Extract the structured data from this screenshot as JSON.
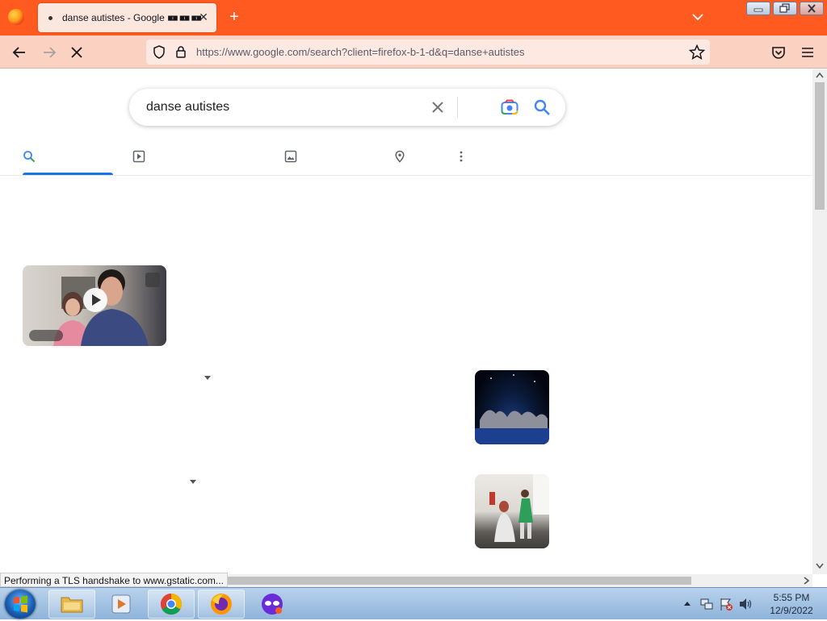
{
  "browser": {
    "tab": {
      "title": "danse autistes - Google",
      "title_suffix": "🀰🀰🀰",
      "close_glyph": "✕"
    },
    "new_tab_glyph": "+",
    "url": "https://www.google.com/search?client=firefox-b-1-d&q=danse+autistes",
    "status_text": "Performing a TLS handshake to www.gstatic.com..."
  },
  "search": {
    "query": "danse autistes"
  },
  "search_tabs": [
    {
      "icon": "search-icon"
    },
    {
      "icon": "video-icon"
    },
    {
      "icon": "image-icon"
    },
    {
      "icon": "map-pin-icon"
    },
    {
      "icon": "more-vert-icon"
    }
  ],
  "taskbar": {
    "apps": [
      "file-explorer",
      "media-player",
      "chrome",
      "firefox",
      "vpn-mask"
    ],
    "time": "5:55 PM",
    "date": "12/9/2022"
  },
  "colors": {
    "titlebar": "#ff5a1f",
    "toolbar": "#fbd2c1",
    "tab_active": "#fbe7de",
    "google_blue": "#1a73e8"
  }
}
